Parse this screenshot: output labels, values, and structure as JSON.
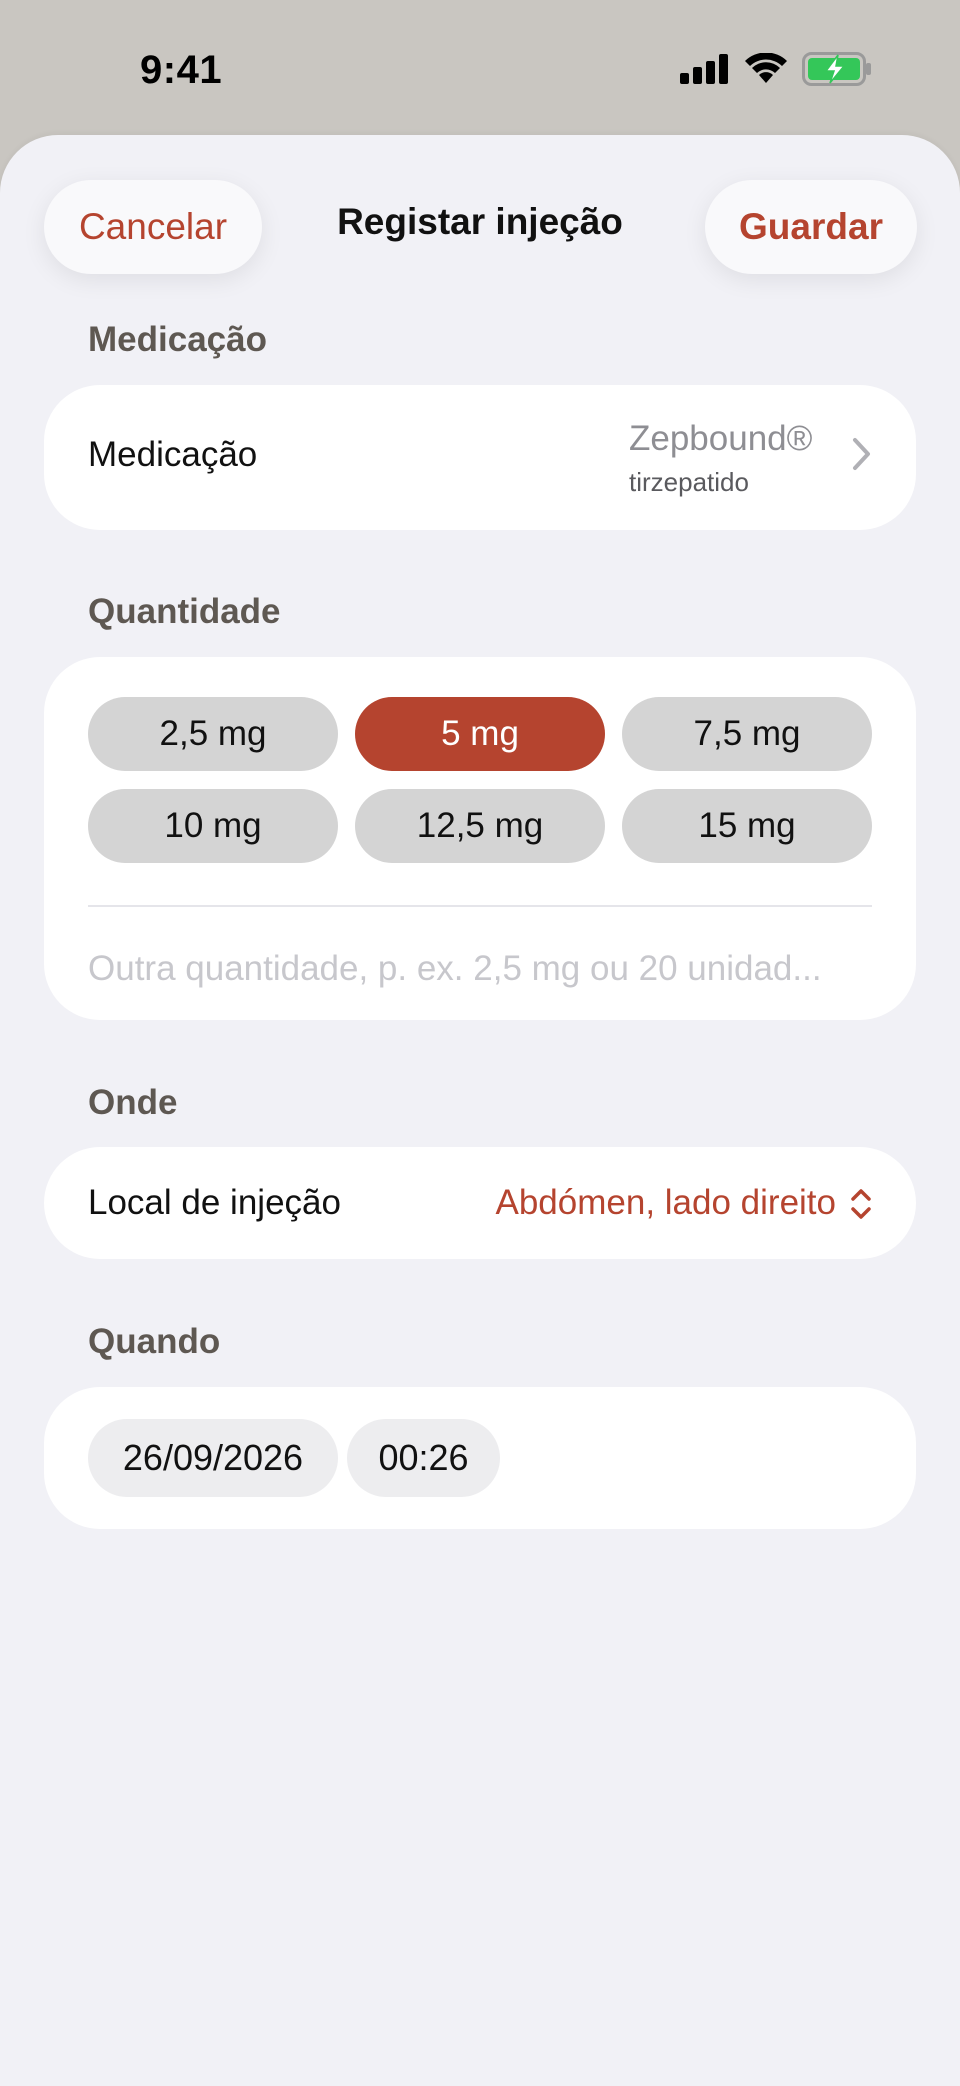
{
  "status_bar": {
    "time": "9:41"
  },
  "nav": {
    "cancel_label": "Cancelar",
    "title": "Registar injeção",
    "save_label": "Guardar"
  },
  "medication": {
    "section_title": "Medicação",
    "row_label": "Medicação",
    "name": "Zepbound®",
    "generic": "tirzepatido"
  },
  "quantity": {
    "section_title": "Quantidade",
    "doses": [
      "2,5 mg",
      "5 mg",
      "7,5 mg",
      "10 mg",
      "12,5 mg",
      "15 mg"
    ],
    "selected": "5 mg",
    "custom_value": "",
    "custom_placeholder": "Outra quantidade, p. ex. 2,5 mg ou 20 unidad..."
  },
  "where": {
    "section_title": "Onde",
    "row_label": "Local de injeção",
    "site_value": "Abdómen, lado direito"
  },
  "when": {
    "section_title": "Quando",
    "date": "26/09/2026",
    "time": "00:26"
  },
  "colors": {
    "accent": "#b5442f",
    "background": "#f1f1f6",
    "chip": "#d4d4d4",
    "battery": "#34c759"
  }
}
